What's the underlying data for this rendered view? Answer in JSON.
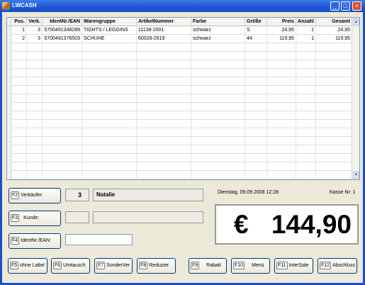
{
  "window": {
    "title": "LWCASH",
    "minimize": "_",
    "maximize": "□",
    "close": "×"
  },
  "table": {
    "headers": [
      "Pos.",
      "Verk.",
      "IdentNr./EAN",
      "Warengruppe",
      "ArtikelNummer",
      "Farbe",
      "Größe",
      "Preis",
      "Anzahl",
      "Gesamt"
    ],
    "rows": [
      [
        "1",
        "3",
        "5700491348289",
        "TIGHTS / LEGGINS",
        "11138-2001",
        "schwarz",
        "S",
        "24,95",
        "1",
        "24,95"
      ],
      [
        "2",
        "3",
        "5700491376503",
        "SCHUHE",
        "60028-2619",
        "schwarz",
        "44",
        "119,95",
        "1",
        "119,95"
      ]
    ],
    "scroll_up": "▲",
    "scroll_down": "▼"
  },
  "form": {
    "verkaeufer_key": "F2",
    "verkaeufer_label": "Verkäufer:",
    "verkaeufer_nr": "3",
    "verkaeufer_name": "Natalie",
    "kunde_key": "F3",
    "kunde_label": "Kunde:",
    "kunde_nr": "",
    "kunde_name": "",
    "ident_key": "F4",
    "ident_label": "IdentNr./EAN:",
    "ident_value": ""
  },
  "status": {
    "datetime": "Dienstag, 09.09.2008  12:28",
    "kasse": "Kasse Nr: 1"
  },
  "total": {
    "currency": "€",
    "amount": "144,90"
  },
  "fbuttons": [
    {
      "key": "F5",
      "label": "ohne Label"
    },
    {
      "key": "F6",
      "label": "Umtausch"
    },
    {
      "key": "F7",
      "label": "SonderVer"
    },
    {
      "key": "F8",
      "label": "Reduzier."
    },
    {
      "key": "F9",
      "label": "Rabatt"
    },
    {
      "key": "F10",
      "label": "Menü"
    },
    {
      "key": "F11",
      "label": "InterSale"
    },
    {
      "key": "F12",
      "label": "Abschluss"
    }
  ]
}
